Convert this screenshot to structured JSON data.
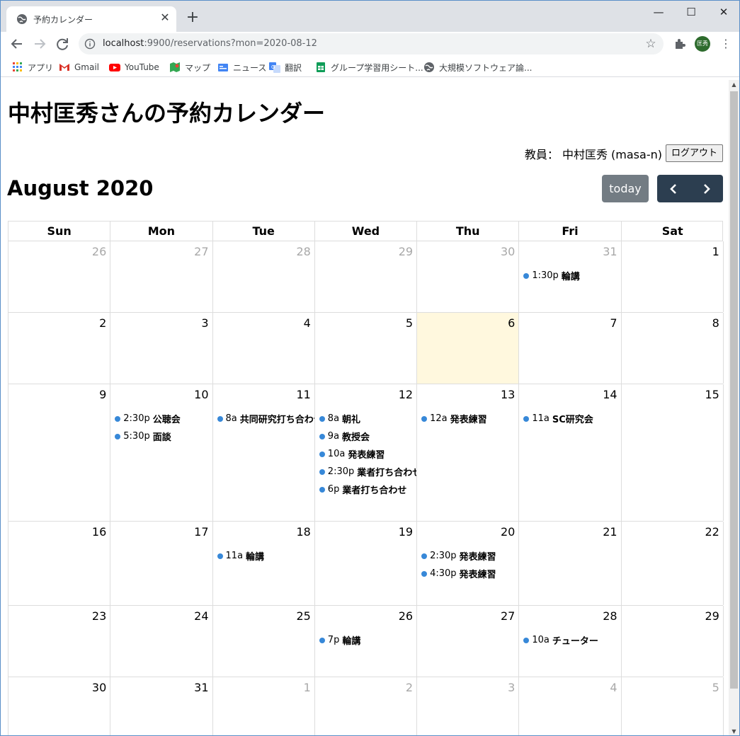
{
  "browser": {
    "tab_title": "予約カレンダー",
    "url_host": "localhost",
    "url_rest": ":9900/reservations?mon=2020-08-12",
    "avatar_text": "匡秀",
    "bookmarks": [
      {
        "label": "アプリ",
        "icon": "apps-grid-icon"
      },
      {
        "label": "Gmail",
        "icon": "gmail-icon"
      },
      {
        "label": "YouTube",
        "icon": "youtube-icon"
      },
      {
        "label": "マップ",
        "icon": "maps-icon"
      },
      {
        "label": "ニュース",
        "icon": "news-icon"
      },
      {
        "label": "翻訳",
        "icon": "translate-icon"
      },
      {
        "label": "グループ学習用シート...",
        "icon": "sheets-icon"
      },
      {
        "label": "大規模ソフトウェア論...",
        "icon": "globe-icon"
      }
    ]
  },
  "page": {
    "title": "中村匡秀さんの予約カレンダー",
    "user_label": "教員： 中村匡秀 (masa-n)",
    "logout_label": "ログアウト",
    "month_title": "August 2020",
    "today_label": "today"
  },
  "colors": {
    "event_dot": "#3788d8",
    "today_bg": "#fff8de",
    "nav_btn": "#2c3e50",
    "today_btn": "#6c757d"
  },
  "calendar": {
    "day_headers": [
      "Sun",
      "Mon",
      "Tue",
      "Wed",
      "Thu",
      "Fri",
      "Sat"
    ],
    "today": "6",
    "weeks": [
      [
        {
          "num": "26",
          "other": true,
          "events": []
        },
        {
          "num": "27",
          "other": true,
          "events": []
        },
        {
          "num": "28",
          "other": true,
          "events": []
        },
        {
          "num": "29",
          "other": true,
          "events": []
        },
        {
          "num": "30",
          "other": true,
          "events": []
        },
        {
          "num": "31",
          "other": true,
          "events": [
            {
              "time": "1:30p",
              "title": "輪講"
            }
          ]
        },
        {
          "num": "1",
          "other": false,
          "events": []
        }
      ],
      [
        {
          "num": "2",
          "other": false,
          "events": []
        },
        {
          "num": "3",
          "other": false,
          "events": []
        },
        {
          "num": "4",
          "other": false,
          "events": []
        },
        {
          "num": "5",
          "other": false,
          "events": []
        },
        {
          "num": "6",
          "other": false,
          "today": true,
          "events": []
        },
        {
          "num": "7",
          "other": false,
          "events": []
        },
        {
          "num": "8",
          "other": false,
          "events": []
        }
      ],
      [
        {
          "num": "9",
          "other": false,
          "events": []
        },
        {
          "num": "10",
          "other": false,
          "events": [
            {
              "time": "2:30p",
              "title": "公聴会"
            },
            {
              "time": "5:30p",
              "title": "面談"
            }
          ]
        },
        {
          "num": "11",
          "other": false,
          "events": [
            {
              "time": "8a",
              "title": "共同研究打ち合わせ"
            }
          ]
        },
        {
          "num": "12",
          "other": false,
          "events": [
            {
              "time": "8a",
              "title": "朝礼"
            },
            {
              "time": "9a",
              "title": "教授会"
            },
            {
              "time": "10a",
              "title": "発表練習"
            },
            {
              "time": "2:30p",
              "title": "業者打ち合わせ"
            },
            {
              "time": "6p",
              "title": "業者打ち合わせ"
            }
          ]
        },
        {
          "num": "13",
          "other": false,
          "events": [
            {
              "time": "12a",
              "title": "発表練習"
            }
          ]
        },
        {
          "num": "14",
          "other": false,
          "events": [
            {
              "time": "11a",
              "title": "SC研究会"
            }
          ]
        },
        {
          "num": "15",
          "other": false,
          "events": []
        }
      ],
      [
        {
          "num": "16",
          "other": false,
          "events": []
        },
        {
          "num": "17",
          "other": false,
          "events": []
        },
        {
          "num": "18",
          "other": false,
          "events": [
            {
              "time": "11a",
              "title": "輪講"
            }
          ]
        },
        {
          "num": "19",
          "other": false,
          "events": []
        },
        {
          "num": "20",
          "other": false,
          "events": [
            {
              "time": "2:30p",
              "title": "発表練習"
            },
            {
              "time": "4:30p",
              "title": "発表練習"
            }
          ]
        },
        {
          "num": "21",
          "other": false,
          "events": []
        },
        {
          "num": "22",
          "other": false,
          "events": []
        }
      ],
      [
        {
          "num": "23",
          "other": false,
          "events": []
        },
        {
          "num": "24",
          "other": false,
          "events": []
        },
        {
          "num": "25",
          "other": false,
          "events": []
        },
        {
          "num": "26",
          "other": false,
          "events": [
            {
              "time": "7p",
              "title": "輪講"
            }
          ]
        },
        {
          "num": "27",
          "other": false,
          "events": []
        },
        {
          "num": "28",
          "other": false,
          "events": [
            {
              "time": "10a",
              "title": "チューター"
            }
          ]
        },
        {
          "num": "29",
          "other": false,
          "events": []
        }
      ],
      [
        {
          "num": "30",
          "other": false,
          "events": []
        },
        {
          "num": "31",
          "other": false,
          "events": []
        },
        {
          "num": "1",
          "other": true,
          "events": []
        },
        {
          "num": "2",
          "other": true,
          "events": []
        },
        {
          "num": "3",
          "other": true,
          "events": []
        },
        {
          "num": "4",
          "other": true,
          "events": []
        },
        {
          "num": "5",
          "other": true,
          "events": []
        }
      ]
    ]
  }
}
